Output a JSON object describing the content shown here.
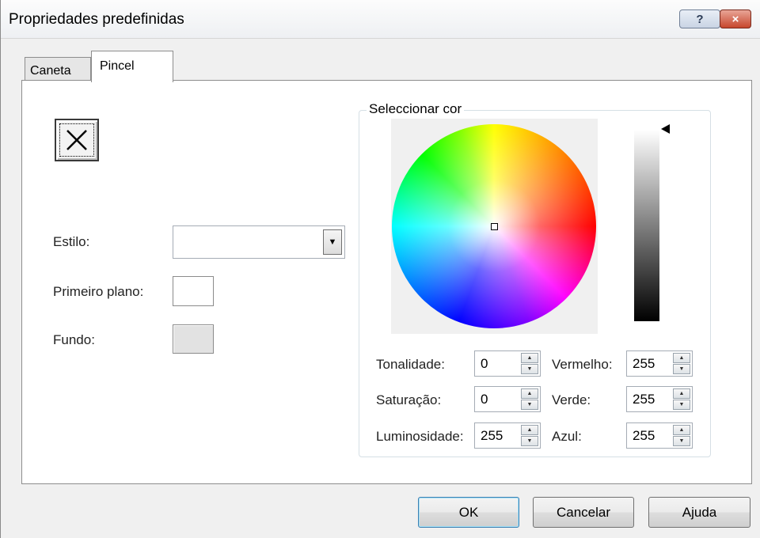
{
  "window": {
    "title": "Propriedades predefinidas",
    "help_glyph": "?",
    "close_glyph": "×"
  },
  "tabs": [
    {
      "label": "Caneta"
    },
    {
      "label": "Pincel"
    }
  ],
  "left": {
    "style_label": "Estilo:",
    "style_value": "",
    "foreground_label": "Primeiro plano:",
    "background_label": "Fundo:",
    "preview_icon": "x-mark-icon"
  },
  "color_picker": {
    "legend": "Seleccionar cor",
    "fields": {
      "hue": {
        "label": "Tonalidade:",
        "value": "0"
      },
      "saturation": {
        "label": "Saturação:",
        "value": "0"
      },
      "luminosity": {
        "label": "Luminosidade:",
        "value": "255"
      },
      "red": {
        "label": "Vermelho:",
        "value": "255"
      },
      "green": {
        "label": "Verde:",
        "value": "255"
      },
      "blue": {
        "label": "Azul:",
        "value": "255"
      }
    }
  },
  "buttons": {
    "ok": "OK",
    "cancel": "Cancelar",
    "help": "Ajuda"
  },
  "colors": {
    "foreground": "#ffffff",
    "background": "#e2e2e2",
    "accent": "#3c7fb1"
  }
}
